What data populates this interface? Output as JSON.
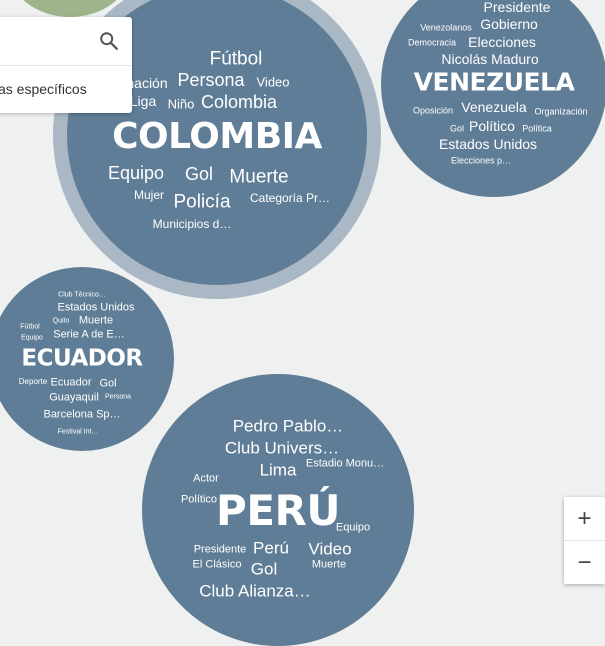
{
  "search": {
    "hint": "as específicos"
  },
  "zoom": {
    "in_label": "+",
    "out_label": "−"
  },
  "bubbles": {
    "colombia": {
      "title": "COLOMBIA",
      "words": [
        "Fútbol",
        "nación",
        "Persona",
        "Video",
        "Liga",
        "Niño",
        "Colombia",
        "Equipo",
        "Gol",
        "Muerte",
        "Mujer",
        "Policía",
        "Categoría Pr…",
        "Municipios d…"
      ]
    },
    "venezuela": {
      "title": "VENEZUELA",
      "words": [
        "Presidente",
        "Venezolanos",
        "Gobierno",
        "Democracia",
        "Elecciones",
        "Nicolás Maduro",
        "Oposición",
        "Venezuela",
        "Organización",
        "Gol",
        "Político",
        "Política",
        "Estados Unidos",
        "Elecciones p…"
      ]
    },
    "ecuador": {
      "title": "ECUADOR",
      "words": [
        "Club Técnico…",
        "Estados Unidos",
        "Quito",
        "Muerte",
        "Fútbol",
        "Equipo",
        "Serie A de E…",
        "Deporte",
        "Ecuador",
        "Gol",
        "Guayaquil",
        "Persona",
        "Barcelona Sp…",
        "Festival Int…"
      ]
    },
    "peru": {
      "title": "PERÚ",
      "words": [
        "Pedro Pablo…",
        "Club Univers…",
        "Lima",
        "Estadio Monu…",
        "Actor",
        "Político",
        "Equipo",
        "Presidente",
        "Perú",
        "Video",
        "El Clásico",
        "Gol",
        "Muerte",
        "Club Alianza…"
      ]
    }
  }
}
